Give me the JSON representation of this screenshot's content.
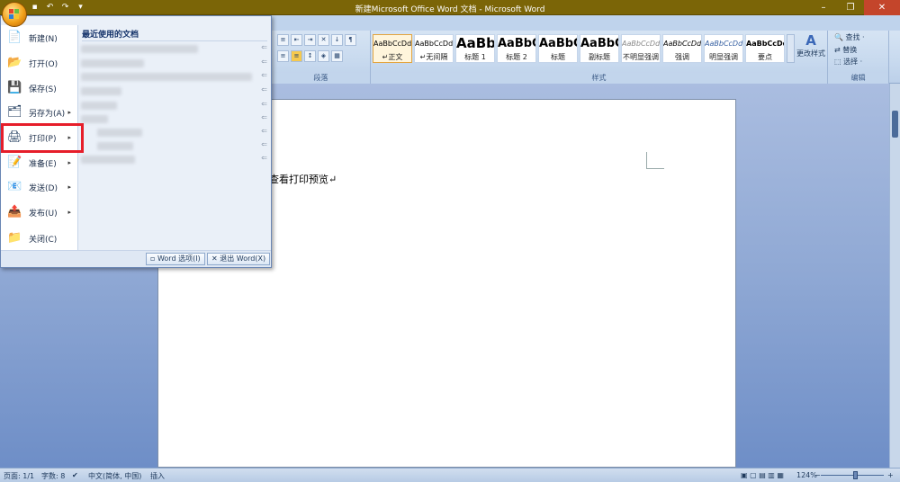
{
  "window": {
    "title": "新建Microsoft Office Word 文档 - Microsoft Word"
  },
  "quick_access": [
    "save-icon",
    "undo-icon",
    "redo-icon",
    "customize-icon"
  ],
  "ribbon": {
    "groups": {
      "paragraph": "段落",
      "styles": "样式",
      "editing": "编辑"
    },
    "styles": [
      {
        "sample": "AaBbCcDd",
        "name": "↵正文"
      },
      {
        "sample": "AaBbCcDd",
        "name": "↵无间隔"
      },
      {
        "sample": "AaBb",
        "name": "标题 1"
      },
      {
        "sample": "AaBbC",
        "name": "标题 2"
      },
      {
        "sample": "AaBbC",
        "name": "标题"
      },
      {
        "sample": "AaBbC",
        "name": "副标题"
      },
      {
        "sample": "AaBbCcDd",
        "name": "不明显强调"
      },
      {
        "sample": "AaBbCcDd",
        "name": "强调"
      },
      {
        "sample": "AaBbCcDd",
        "name": "明显强调"
      },
      {
        "sample": "AaBbCcDd",
        "name": "要点"
      }
    ],
    "change_styles": "更改样式",
    "editing": {
      "find": "查找 ·",
      "replace": "替换",
      "select": "选择 ·"
    }
  },
  "office_menu": {
    "items": [
      {
        "label": "新建(N)",
        "icon": "new-doc-icon"
      },
      {
        "label": "打开(O)",
        "icon": "open-folder-icon"
      },
      {
        "label": "保存(S)",
        "icon": "save-icon"
      },
      {
        "label": "另存为(A)",
        "icon": "save-as-icon"
      },
      {
        "label": "打印(P)",
        "icon": "printer-icon"
      },
      {
        "label": "准备(E)",
        "icon": "prepare-icon"
      },
      {
        "label": "发送(D)",
        "icon": "send-icon"
      },
      {
        "label": "发布(U)",
        "icon": "publish-icon"
      },
      {
        "label": "关闭(C)",
        "icon": "close-folder-icon"
      }
    ],
    "recent_title": "最近使用的文档",
    "word_options": "Word 选项(I)",
    "exit_word": "退出 Word(X)"
  },
  "document": {
    "text": "查看打印预览↵"
  },
  "statusbar": {
    "page": "页面: 1/1",
    "words": "字数: 8",
    "language": "中文(简体, 中国)",
    "mode": "插入",
    "zoom": "124%"
  },
  "colors": {
    "title_bar": "#7b6507",
    "highlight": "#e61e2a",
    "accent": "#3a67b7"
  }
}
